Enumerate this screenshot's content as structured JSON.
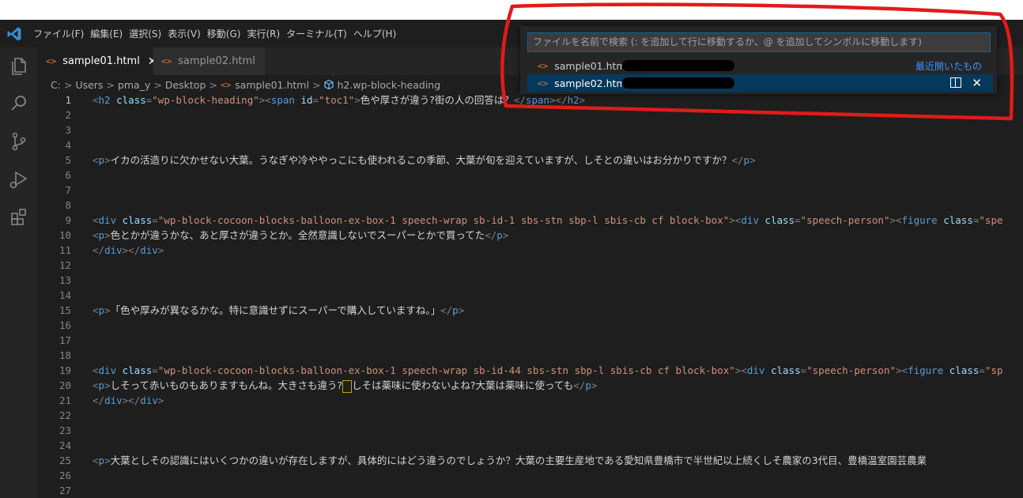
{
  "menu": [
    "ファイル(F)",
    "編集(E)",
    "選択(S)",
    "表示(V)",
    "移動(G)",
    "実行(R)",
    "ターミナル(T)",
    "ヘルプ(H)"
  ],
  "tabs": [
    {
      "label": "sample01.html",
      "active": true,
      "close": "✕"
    },
    {
      "label": "sample02.html",
      "active": false
    }
  ],
  "breadcrumb": {
    "parts": [
      "C:",
      "Users",
      "pma_y",
      "Desktop"
    ],
    "file": "sample01.html",
    "symbol": "h2.wp-block-heading",
    "separator": ">"
  },
  "quickopen": {
    "placeholder": "ファイルを名前で検索 (: を追加して行に移動するか、@ を追加してシンボルに移動します)",
    "items": [
      {
        "label": "sample01.html",
        "selected": false,
        "hint": "最近開いたもの"
      },
      {
        "label": "sample02.html",
        "selected": true,
        "close": "✕"
      }
    ]
  },
  "code": {
    "current_line": 1,
    "lines": [
      {
        "n": "1",
        "tokens": [
          [
            "br",
            "<"
          ],
          [
            "tg",
            "h2"
          ],
          [
            "at",
            " class"
          ],
          [
            "br",
            "="
          ],
          [
            "sv",
            "\"wp-block-heading\""
          ],
          [
            "br",
            ">"
          ],
          [
            "br",
            "<"
          ],
          [
            "tg",
            "span"
          ],
          [
            "at",
            " id"
          ],
          [
            "br",
            "="
          ],
          [
            "sv",
            "\"toc1\""
          ],
          [
            "br",
            ">"
          ],
          [
            "tx",
            "色や厚さが違う?街の人の回答は？"
          ],
          [
            "br",
            "</"
          ],
          [
            "tg",
            "span"
          ],
          [
            "br",
            "></"
          ],
          [
            "tg",
            "h2"
          ],
          [
            "br",
            ">"
          ]
        ]
      },
      {
        "n": "2",
        "tokens": []
      },
      {
        "n": "3",
        "tokens": []
      },
      {
        "n": "4",
        "tokens": []
      },
      {
        "n": "5",
        "tokens": [
          [
            "br",
            "<"
          ],
          [
            "tg",
            "p"
          ],
          [
            "br",
            ">"
          ],
          [
            "tx",
            "イカの活造りに欠かせない大葉。うなぎや冷ややっこにも使われるこの季節、大葉が旬を迎えていますが、しそとの違いはお分かりですか？"
          ],
          [
            "br",
            "</"
          ],
          [
            "tg",
            "p"
          ],
          [
            "br",
            ">"
          ]
        ]
      },
      {
        "n": "6",
        "tokens": []
      },
      {
        "n": "7",
        "tokens": []
      },
      {
        "n": "8",
        "tokens": []
      },
      {
        "n": "9",
        "tokens": [
          [
            "br",
            "<"
          ],
          [
            "tg",
            "div"
          ],
          [
            "at",
            " class"
          ],
          [
            "br",
            "="
          ],
          [
            "sv",
            "\"wp-block-cocoon-blocks-balloon-ex-box-1 speech-wrap sb-id-1 sbs-stn sbp-l sbis-cb cf block-box\""
          ],
          [
            "br",
            ">"
          ],
          [
            "br",
            "<"
          ],
          [
            "tg",
            "div"
          ],
          [
            "at",
            " class"
          ],
          [
            "br",
            "="
          ],
          [
            "sv",
            "\"speech-person\""
          ],
          [
            "br",
            ">"
          ],
          [
            "br",
            "<"
          ],
          [
            "tg",
            "figure"
          ],
          [
            "at",
            " class"
          ],
          [
            "br",
            "="
          ],
          [
            "sv",
            "\"spe"
          ]
        ]
      },
      {
        "n": "10",
        "tokens": [
          [
            "br",
            "<"
          ],
          [
            "tg",
            "p"
          ],
          [
            "br",
            ">"
          ],
          [
            "tx",
            "色とかが違うかな、あと厚さが違うとか。全然意識しないでスーパーとかで買ってた"
          ],
          [
            "br",
            "</"
          ],
          [
            "tg",
            "p"
          ],
          [
            "br",
            ">"
          ]
        ]
      },
      {
        "n": "11",
        "tokens": [
          [
            "br",
            "</"
          ],
          [
            "tg",
            "div"
          ],
          [
            "br",
            "></"
          ],
          [
            "tg",
            "div"
          ],
          [
            "br",
            ">"
          ]
        ]
      },
      {
        "n": "12",
        "tokens": []
      },
      {
        "n": "13",
        "tokens": []
      },
      {
        "n": "14",
        "tokens": []
      },
      {
        "n": "15",
        "tokens": [
          [
            "br",
            "<"
          ],
          [
            "tg",
            "p"
          ],
          [
            "br",
            ">"
          ],
          [
            "tx",
            "「色や厚みが異なるかな。特に意識せずにスーパーで購入していますね。」"
          ],
          [
            "br",
            "</"
          ],
          [
            "tg",
            "p"
          ],
          [
            "br",
            ">"
          ]
        ]
      },
      {
        "n": "16",
        "tokens": []
      },
      {
        "n": "17",
        "tokens": []
      },
      {
        "n": "18",
        "tokens": []
      },
      {
        "n": "19",
        "tokens": [
          [
            "br",
            "<"
          ],
          [
            "tg",
            "div"
          ],
          [
            "at",
            " class"
          ],
          [
            "br",
            "="
          ],
          [
            "sv",
            "\"wp-block-cocoon-blocks-balloon-ex-box-1 speech-wrap sb-id-44 sbs-stn sbp-l sbis-cb cf block-box\""
          ],
          [
            "br",
            ">"
          ],
          [
            "br",
            "<"
          ],
          [
            "tg",
            "div"
          ],
          [
            "at",
            " class"
          ],
          [
            "br",
            "="
          ],
          [
            "sv",
            "\"speech-person\""
          ],
          [
            "br",
            ">"
          ],
          [
            "br",
            "<"
          ],
          [
            "tg",
            "figure"
          ],
          [
            "at",
            " class"
          ],
          [
            "br",
            "="
          ],
          [
            "sv",
            "\"sp"
          ]
        ]
      },
      {
        "n": "20",
        "tokens": [
          [
            "br",
            "<"
          ],
          [
            "tg",
            "p"
          ],
          [
            "br",
            ">"
          ],
          [
            "tx",
            "しそって赤いものもありますもんね。大きさも違う?"
          ],
          [
            "box",
            ""
          ],
          [
            "tx",
            "しそは薬味に使わないよね?大葉は薬味に使っても"
          ],
          [
            "br",
            "</"
          ],
          [
            "tg",
            "p"
          ],
          [
            "br",
            ">"
          ]
        ]
      },
      {
        "n": "21",
        "tokens": [
          [
            "br",
            "</"
          ],
          [
            "tg",
            "div"
          ],
          [
            "br",
            "></"
          ],
          [
            "tg",
            "div"
          ],
          [
            "br",
            ">"
          ]
        ]
      },
      {
        "n": "22",
        "tokens": []
      },
      {
        "n": "23",
        "tokens": []
      },
      {
        "n": "24",
        "tokens": []
      },
      {
        "n": "25",
        "tokens": [
          [
            "br",
            "<"
          ],
          [
            "tg",
            "p"
          ],
          [
            "br",
            ">"
          ],
          [
            "tx",
            "大葉としその認識にはいくつかの違いが存在しますが、具体的にはどう違うのでしょうか？大葉の主要生産地である愛知県豊橋市で半世紀以上続くしそ農家の3代目、豊橋温室園芸農業"
          ]
        ]
      },
      {
        "n": "26",
        "tokens": []
      },
      {
        "n": "27",
        "tokens": []
      }
    ]
  },
  "colors": {
    "annotation": "#e01b1b",
    "accent": "#0e639c",
    "tag": "#569cd6",
    "attr": "#9cdcfe",
    "string": "#ce9178"
  }
}
